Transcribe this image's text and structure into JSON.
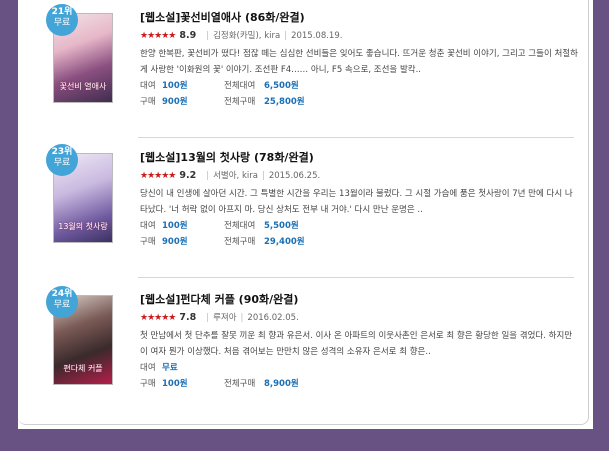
{
  "items": [
    {
      "rank": "21위",
      "badge_free": "무료",
      "cover_text": "꽃선비 열애사",
      "title": "[웹소설]꽃선비열애사 (86화/완결)",
      "stars": "★★★★★",
      "rating": "8.9",
      "author": "김정화(카밀)",
      "publisher": "kira",
      "date": "2015.08.19.",
      "description": "한양 한복판, 꽃선비가 떴다! 점잖 떼는 심심한 선비들은 잊어도 좋습니다. 뜨거운 청춘 꽃선비 이야기, 그리고 그들이 처절하게 사랑한 '이화원의 꽃' 이야기. 조선판 F4…… 아니, F5 속으로, 조선을 발칵..",
      "rent_label": "대여",
      "rent_price": "100원",
      "rent_all_label": "전체대여",
      "rent_all_price": "6,500원",
      "buy_label": "구매",
      "buy_price": "900원",
      "buy_all_label": "전체구매",
      "buy_all_price": "25,800원"
    },
    {
      "rank": "23위",
      "badge_free": "무료",
      "cover_text": "13월의 첫사랑",
      "title": "[웹소설]13월의 첫사랑 (78화/완결)",
      "stars": "★★★★★",
      "rating": "9.2",
      "author": "서별아",
      "publisher": "kira",
      "date": "2015.06.25.",
      "description": "당신이 내 인생에 살아던 시간. 그 특별한 시간을 우리는 13월이라 불렀다. 그 시절 가슴에 품은 첫사랑이 7년 만에 다시 나타났다. '너 허락 없이 아프지 마. 당신 상처도 전부 내 거야.' 다시 만난 운명은 ..",
      "rent_label": "대여",
      "rent_price": "100원",
      "rent_all_label": "전체대여",
      "rent_all_price": "5,500원",
      "buy_label": "구매",
      "buy_price": "900원",
      "buy_all_label": "전체구매",
      "buy_all_price": "29,400원"
    },
    {
      "rank": "24위",
      "badge_free": "무료",
      "cover_text": "편다체 커플",
      "title": "[웹소설]펀다체 커플 (90화/완결)",
      "stars": "★★★★★",
      "rating": "7.8",
      "author": "루져아",
      "publisher": "",
      "date": "2016.02.05.",
      "description": "첫 만남에서 첫 단추를 잘못 끼운 최 향과 유은서. 이사 온 아파트의 이웃사촌인 은서로 최 향은 황당한 일을 겪었다. 하지만 이 여자 뭔가 이상했다. 처음 겪어보는 만만치 않은 성격의 소유자 은서로 최 향은..",
      "rent_label": "대여",
      "rent_price": "무료",
      "rent_all_label": "",
      "rent_all_price": "",
      "buy_label": "구매",
      "buy_price": "100원",
      "buy_all_label": "전체구매",
      "buy_all_price": "8,900원"
    }
  ]
}
